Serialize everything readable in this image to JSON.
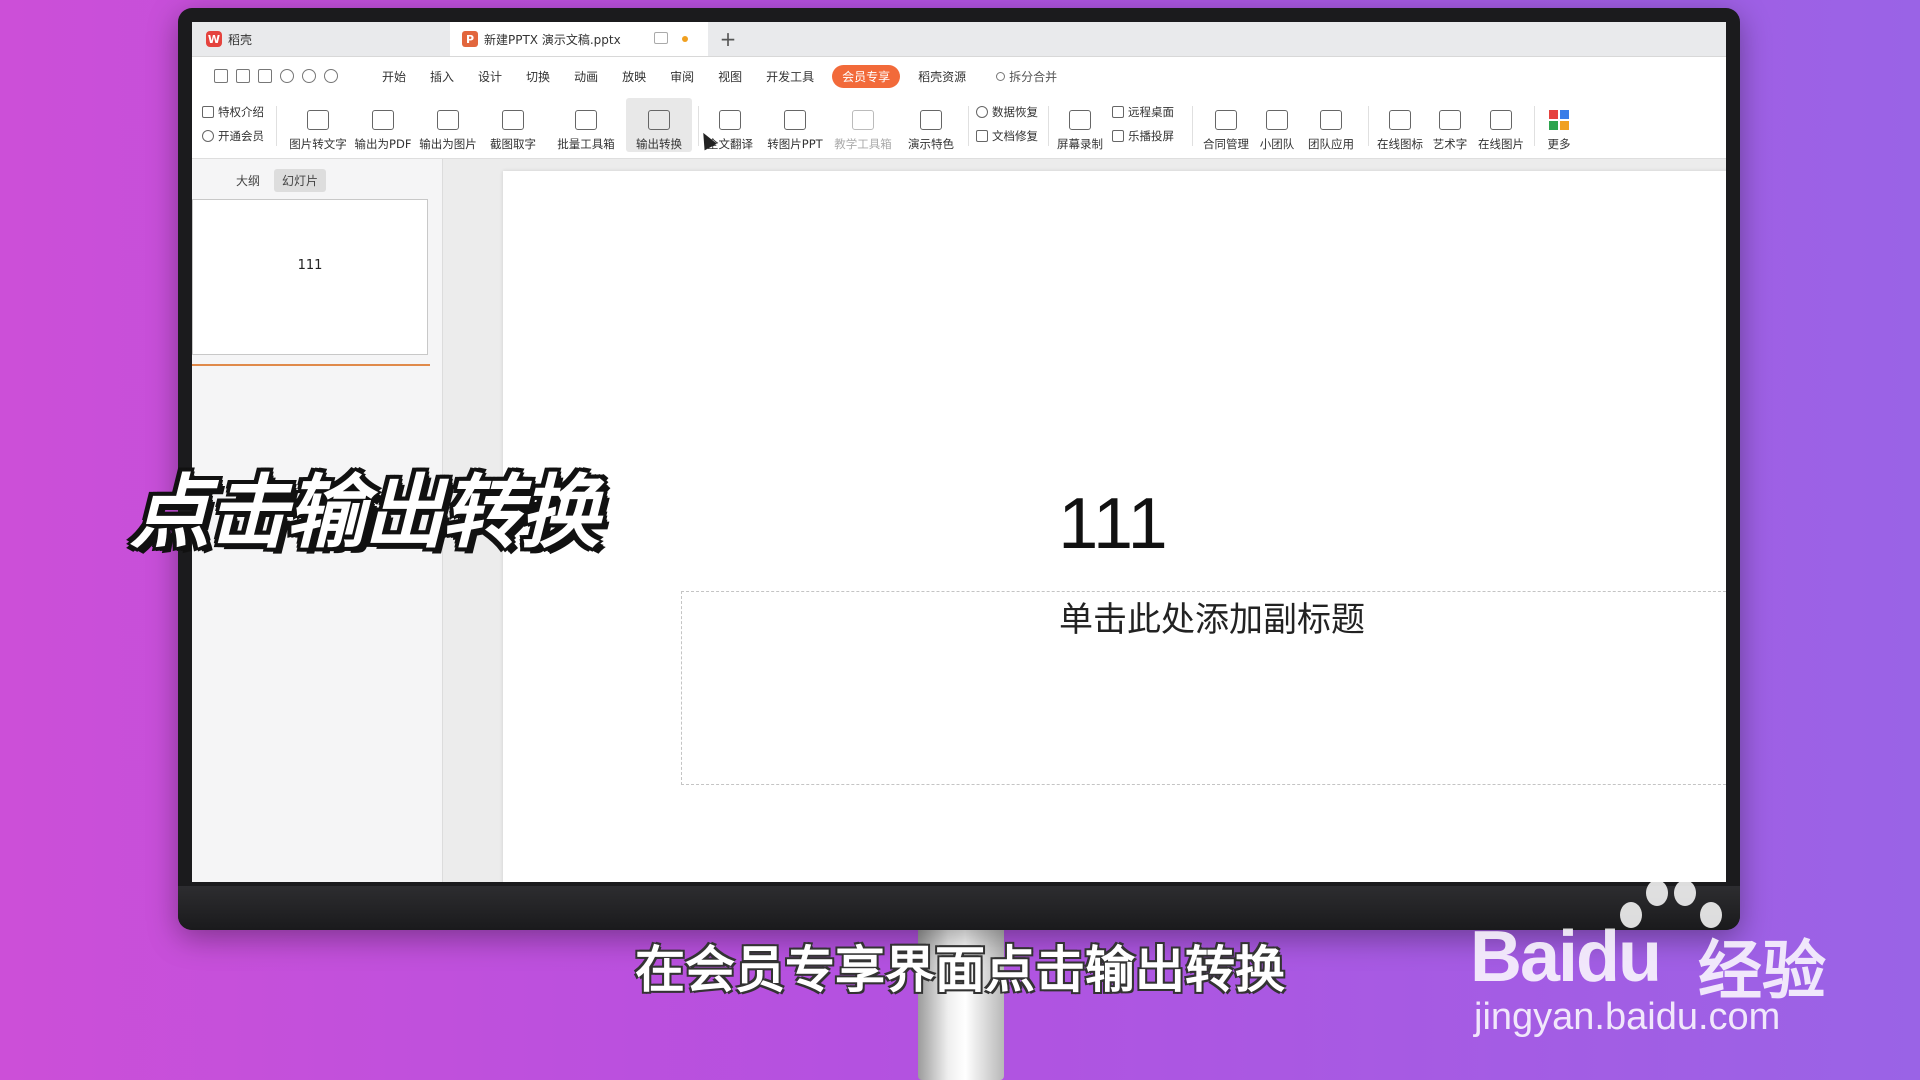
{
  "tabs": {
    "home_label": "稻壳",
    "doc_label": "新建PPTX 演示文稿.pptx",
    "new_tab_symbol": "+"
  },
  "menu": {
    "items": [
      "开始",
      "插入",
      "设计",
      "切换",
      "动画",
      "放映",
      "审阅",
      "视图",
      "开发工具"
    ],
    "active": "会员专享",
    "after": "稻壳资源",
    "search": "拆分合并"
  },
  "ribbon": {
    "left_small": [
      "特权介绍",
      "开通会员"
    ],
    "buttons": [
      "图片转文字",
      "输出为PDF",
      "输出为图片",
      "截图取字",
      "批量工具箱",
      "输出转换",
      "全文翻译",
      "转图片PPT",
      "教学工具箱",
      "演示特色"
    ],
    "mid_small": [
      "数据恢复",
      "文档修复"
    ],
    "buttons2": [
      "屏幕录制"
    ],
    "mid_small2": [
      "远程桌面",
      "乐播投屏"
    ],
    "buttons3": [
      "合同管理",
      "小团队",
      "团队应用",
      "在线图标",
      "艺术字",
      "在线图片",
      "更多"
    ]
  },
  "left_pane": {
    "tab_outline": "大纲",
    "tab_slides": "幻灯片",
    "thumb_text": "111"
  },
  "slide": {
    "title": "111",
    "subtitle_placeholder": "单击此处添加副标题"
  },
  "overlay": {
    "title": "点击输出转换",
    "caption": "在会员专享界面点击输出转换"
  },
  "watermark": {
    "brand": "Bai",
    "brand_du": "du",
    "cn": "经验",
    "url": "jingyan.baidu.com"
  },
  "colors": {
    "accent": "#f26a3a",
    "background_left": "#cc4fd8",
    "background_right": "#9a63e6"
  }
}
